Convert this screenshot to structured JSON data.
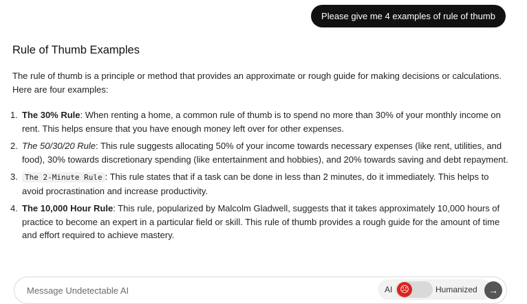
{
  "user_message": "Please give me 4 examples of rule of thumb",
  "answer": {
    "title": "Rule of Thumb Examples",
    "intro": "The rule of thumb is a principle or method that provides an approximate or rough guide for making decisions or calculations. Here are four examples:",
    "items": [
      {
        "num": "1.",
        "name": "The 30% Rule",
        "text": ": When renting a home, a common rule of thumb is to spend no more than 30% of your monthly income on rent. This helps ensure that you have enough money left over for other expenses."
      },
      {
        "num": "2.",
        "name": "The 50/30/20 Rule",
        "text": ": This rule suggests allocating 50% of your income towards necessary expenses (like rent, utilities, and food), 30% towards discretionary spending (like entertainment and hobbies), and 20% towards saving and debt repayment."
      },
      {
        "num": "3.",
        "name": "The 2-Minute Rule",
        "text": ": This rule states that if a task can be done in less than 2 minutes, do it immediately. This helps to avoid procrastination and increase productivity."
      },
      {
        "num": "4.",
        "name": "The 10,000 Hour Rule",
        "text": ": This rule, popularized by Malcolm Gladwell, suggests that it takes approximately 10,000 hours of practice to become an expert in a particular field or skill. This rule of thumb provides a rough guide for the amount of time and effort required to achieve mastery."
      }
    ]
  },
  "composer": {
    "placeholder": "Message Undetectable AI",
    "toggle_left": "AI",
    "toggle_right": "Humanized",
    "knob_icon": "sad-face-icon",
    "knob_glyph": "☹",
    "send_glyph": "→"
  },
  "colors": {
    "user_bubble": "#111111",
    "knob": "#d9241c",
    "send": "#555555"
  }
}
